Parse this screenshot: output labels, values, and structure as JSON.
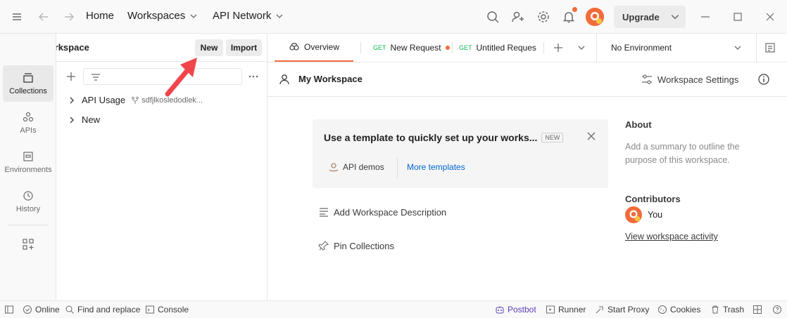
{
  "topbar": {
    "nav": [
      "Home",
      "Workspaces",
      "API Network"
    ],
    "upgrade_label": "Upgrade"
  },
  "workspace": {
    "name": "My Workspace",
    "new_button": "New",
    "import_button": "Import"
  },
  "rail": {
    "items": [
      "Collections",
      "APIs",
      "Environments",
      "History"
    ]
  },
  "sidebar": {
    "collections": [
      {
        "name": "API Usage",
        "fork": "sdfjlkosledodlek..."
      },
      {
        "name": "New"
      }
    ]
  },
  "tabs": {
    "overview": "Overview",
    "requests": [
      {
        "method": "GET",
        "name": "New Request"
      },
      {
        "method": "GET",
        "name": "Untitled Request"
      }
    ],
    "environment": "No Environment"
  },
  "overview": {
    "title": "My Workspace",
    "settings_label": "Workspace Settings",
    "card_title": "Use a template to quickly set up your works...",
    "card_badge": "NEW",
    "api_demos": "API demos",
    "more_templates": "More templates",
    "add_description": "Add Workspace Description",
    "pin_collections": "Pin Collections",
    "about_heading": "About",
    "about_text": "Add a summary to outline the purpose of this workspace.",
    "contributors_heading": "Contributors",
    "contributor_name": "You",
    "activity_link": "View workspace activity"
  },
  "statusbar": {
    "online": "Online",
    "find_replace": "Find and replace",
    "console": "Console",
    "postbot": "Postbot",
    "runner": "Runner",
    "start_proxy": "Start Proxy",
    "cookies": "Cookies",
    "trash": "Trash"
  },
  "colors": {
    "accent": "#f26b3a",
    "link": "#0265d2",
    "get_method": "#0cbb52",
    "annotation_arrow": "#f0464b"
  }
}
